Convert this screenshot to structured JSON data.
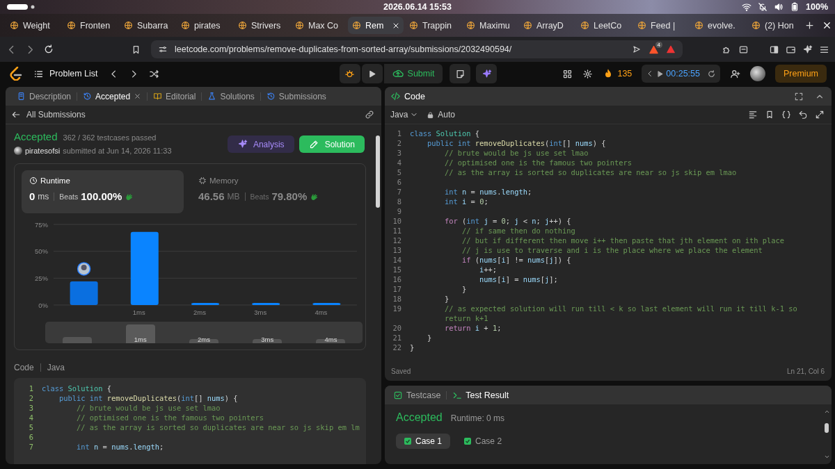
{
  "system_bar": {
    "date_time": "2026.06.14 15:53",
    "battery": "100%"
  },
  "browser": {
    "tabs": [
      {
        "label": "Weight",
        "selected": false
      },
      {
        "label": "Fronten",
        "selected": false
      },
      {
        "label": "Subarra",
        "selected": false
      },
      {
        "label": "pirates",
        "selected": false
      },
      {
        "label": "Strivers",
        "selected": false
      },
      {
        "label": "Max Co",
        "selected": false
      },
      {
        "label": "Rem",
        "selected": true
      },
      {
        "label": "Trappin",
        "selected": false
      },
      {
        "label": "Maximu",
        "selected": false
      },
      {
        "label": "ArrayD",
        "selected": false
      },
      {
        "label": "LeetCo",
        "selected": false
      },
      {
        "label": "Feed |",
        "selected": false
      },
      {
        "label": "evolve.",
        "selected": false
      },
      {
        "label": "(2) Hon",
        "selected": false
      }
    ],
    "address": "leetcode.com/problems/remove-duplicates-from-sorted-array/submissions/2032490594/",
    "shields_badge": "4"
  },
  "toolbar": {
    "problem_list": "Problem List",
    "submit": "Submit",
    "streak": "135",
    "timer": "00:25:55",
    "premium": "Premium"
  },
  "left_panel": {
    "tabs": [
      {
        "label": "Description",
        "selected": false,
        "closable": false
      },
      {
        "label": "Accepted",
        "selected": true,
        "closable": true
      },
      {
        "label": "Editorial",
        "selected": false,
        "closable": false
      },
      {
        "label": "Solutions",
        "selected": false,
        "closable": false
      },
      {
        "label": "Submissions",
        "selected": false,
        "closable": false
      }
    ],
    "back_link": "All Submissions",
    "result": {
      "status": "Accepted",
      "testcases": "362 / 362 testcases passed",
      "user": "piratesofsi",
      "submitted": "submitted at Jun 14, 2026 11:33"
    },
    "buttons": [
      {
        "label": "Analysis",
        "kind": "ai"
      },
      {
        "label": "Solution",
        "kind": "primary"
      }
    ],
    "metrics": [
      {
        "title": "Runtime",
        "value": "0",
        "unit": "ms",
        "beats_label": "Beats",
        "beats": "100.00%",
        "selected": true
      },
      {
        "title": "Memory",
        "value": "46.56",
        "unit": "MB",
        "beats_label": "Beats",
        "beats": "79.80%",
        "selected": false
      }
    ],
    "chart_data": {
      "type": "bar",
      "categories": [
        null,
        "1ms",
        "2ms",
        "3ms",
        "4ms"
      ],
      "values": [
        22,
        68,
        1,
        1,
        1
      ],
      "ylim": [
        0,
        75
      ],
      "yticks": [
        {
          "value": 0,
          "label": "0%"
        },
        {
          "value": 25,
          "label": "25%"
        },
        {
          "value": 50,
          "label": "50%"
        },
        {
          "value": 75,
          "label": "75%"
        }
      ]
    },
    "range_labels": [
      "1ms",
      "2ms",
      "3ms",
      "4ms"
    ],
    "code_label": "Code",
    "language": "Java",
    "code": [
      {
        "n": "1",
        "t": [
          {
            "kw": "class "
          },
          {
            "ty": "Solution"
          },
          {
            "pl": " {"
          }
        ]
      },
      {
        "n": "2",
        "t": [
          {
            "kw": "    public int "
          },
          {
            "fn": "removeDuplicates"
          },
          {
            "pl": "("
          },
          {
            "kw": "int"
          },
          {
            "pl": "[] "
          },
          {
            "var": "nums"
          },
          {
            "pl": ") {"
          }
        ]
      },
      {
        "n": "3",
        "t": [
          {
            "cm": "        // brute would be js use set lmao"
          }
        ]
      },
      {
        "n": "4",
        "t": [
          {
            "cm": "        // optimised one is the famous two pointers"
          }
        ]
      },
      {
        "n": "5",
        "t": [
          {
            "cm": "        // as the array is sorted so duplicates are near so js skip em lm"
          }
        ]
      },
      {
        "n": "6"
      },
      {
        "n": "7",
        "t": [
          {
            "kw": "        int "
          },
          {
            "var": "n"
          },
          {
            "pl": " = "
          },
          {
            "var": "nums"
          },
          {
            "pl": "."
          },
          {
            "var": "length"
          },
          {
            "pl": ";"
          }
        ]
      }
    ]
  },
  "editor": {
    "title": "Code",
    "language": "Java",
    "mode": "Auto",
    "lines": [
      {
        "n": "1",
        "t": [
          {
            "kw": "class "
          },
          {
            "ty": "Solution"
          },
          {
            "pl": " {"
          }
        ]
      },
      {
        "n": "2",
        "t": [
          {
            "kw": "    public int "
          },
          {
            "fn": "removeDuplicates"
          },
          {
            "pl": "("
          },
          {
            "kw": "int"
          },
          {
            "pl": "[] "
          },
          {
            "var": "nums"
          },
          {
            "pl": ") {"
          }
        ]
      },
      {
        "n": "3",
        "t": [
          {
            "cm": "        // brute would be js use set lmao"
          }
        ]
      },
      {
        "n": "4",
        "t": [
          {
            "cm": "        // optimised one is the famous two pointers"
          }
        ]
      },
      {
        "n": "5",
        "t": [
          {
            "cm": "        // as the array is sorted so duplicates are near so js skip em lmao"
          }
        ]
      },
      {
        "n": "6"
      },
      {
        "n": "7",
        "t": [
          {
            "kw": "        int "
          },
          {
            "var": "n"
          },
          {
            "pl": " = "
          },
          {
            "var": "nums"
          },
          {
            "pl": "."
          },
          {
            "var": "length"
          },
          {
            "pl": ";"
          }
        ]
      },
      {
        "n": "8",
        "t": [
          {
            "kw": "        int "
          },
          {
            "var": "i"
          },
          {
            "pl": " = "
          },
          {
            "num": "0"
          },
          {
            "pl": ";"
          }
        ]
      },
      {
        "n": "9"
      },
      {
        "n": "10",
        "t": [
          {
            "ctl": "        for"
          },
          {
            "pl": " ("
          },
          {
            "kw": "int "
          },
          {
            "var": "j"
          },
          {
            "pl": " = "
          },
          {
            "num": "0"
          },
          {
            "pl": "; "
          },
          {
            "var": "j"
          },
          {
            "pl": " < "
          },
          {
            "var": "n"
          },
          {
            "pl": "; "
          },
          {
            "var": "j"
          },
          {
            "pl": "++) {"
          }
        ]
      },
      {
        "n": "11",
        "t": [
          {
            "cm": "            // if same then do nothing"
          }
        ]
      },
      {
        "n": "12",
        "t": [
          {
            "cm": "            // but if different then move i++ then paste that jth element on ith place"
          }
        ]
      },
      {
        "n": "13",
        "t": [
          {
            "cm": "            // j is use to traverse and i is the place where we place the element"
          }
        ]
      },
      {
        "n": "14",
        "t": [
          {
            "ctl": "            if"
          },
          {
            "pl": " ("
          },
          {
            "var": "nums"
          },
          {
            "pl": "["
          },
          {
            "var": "i"
          },
          {
            "pl": "] != "
          },
          {
            "var": "nums"
          },
          {
            "pl": "["
          },
          {
            "var": "j"
          },
          {
            "pl": "]) {"
          }
        ]
      },
      {
        "n": "15",
        "t": [
          {
            "var": "                i"
          },
          {
            "pl": "++;"
          }
        ]
      },
      {
        "n": "16",
        "t": [
          {
            "var": "                nums"
          },
          {
            "pl": "["
          },
          {
            "var": "i"
          },
          {
            "pl": "] = "
          },
          {
            "var": "nums"
          },
          {
            "pl": "["
          },
          {
            "var": "j"
          },
          {
            "pl": "];"
          }
        ]
      },
      {
        "n": "17",
        "t": [
          {
            "pl": "            }"
          }
        ]
      },
      {
        "n": "18",
        "t": [
          {
            "pl": "        }"
          }
        ]
      },
      {
        "n": "19",
        "t": [
          {
            "cm": "        // as expected solution will run till < k so last element will run it till k-1 so return k+1"
          }
        ]
      },
      {
        "n": "20",
        "t": [
          {
            "ctl": "        return "
          },
          {
            "var": "i"
          },
          {
            "pl": " + "
          },
          {
            "num": "1"
          },
          {
            "pl": ";"
          }
        ]
      },
      {
        "n": "21",
        "t": [
          {
            "pl": "    }"
          }
        ]
      },
      {
        "n": "22",
        "t": [
          {
            "pl": "}"
          }
        ]
      }
    ],
    "status": "Saved",
    "cursor": "Ln 21, Col 6"
  },
  "console": {
    "tabs": [
      {
        "label": "Testcase",
        "selected": false
      },
      {
        "label": "Test Result",
        "selected": true
      }
    ],
    "status": "Accepted",
    "runtime": "Runtime: 0 ms",
    "cases": [
      {
        "label": "Case 1",
        "selected": true
      },
      {
        "label": "Case 2",
        "selected": false
      }
    ]
  }
}
